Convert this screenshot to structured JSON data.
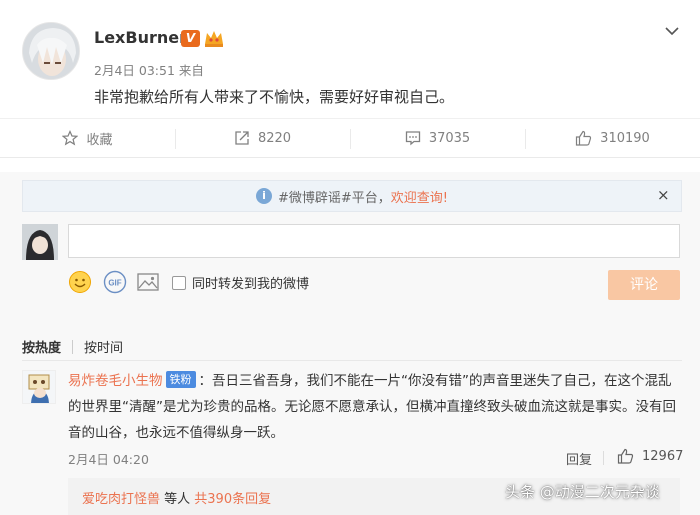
{
  "post": {
    "username": "LexBurner",
    "verified_badge": "V",
    "meta": "2月4日 03:51 来自",
    "text": "非常抱歉给所有人带来了不愉快，需要好好审视自己。"
  },
  "actions": {
    "favorite_label": "收藏",
    "forward_count": "8220",
    "comment_count": "37035",
    "like_count": "310190"
  },
  "notice": {
    "prefix": "#微博辟谣#平台，",
    "link": "欢迎查询!",
    "close": "×"
  },
  "composer": {
    "forward_checkbox_label": "同时转发到我的微博",
    "submit_label": "评论",
    "gif_label": "GIF"
  },
  "sort": {
    "hot": "按热度",
    "time": "按时间"
  },
  "comment": {
    "author": "易炸卷毛小生物",
    "fan_badge": "铁粉",
    "text": "：吾日三省吾身，我们不能在一片“你没有错”的声音里迷失了自己，在这个混乱的世界里“清醒”是尤为珍贵的品格。无论愿不愿意承认，但横冲直撞终致头破血流这就是事实。没有回音的山谷，也永远不值得纵身一跃。",
    "time": "2月4日 04:20",
    "reply_label": "回复",
    "likes": "12967",
    "sub_reply_user": "爱吃肉打怪兽",
    "sub_reply_mid": " 等人 ",
    "sub_reply_count": "共390条回复"
  },
  "watermark": "头条 @动漫二次元杂谈",
  "colors": {
    "accent": "#eb7350",
    "submit_disabled": "#f9c7a3",
    "notice_bg": "#eef3f8",
    "badge_blue": "#4c8be0",
    "verified_orange": "#e96a1d"
  }
}
